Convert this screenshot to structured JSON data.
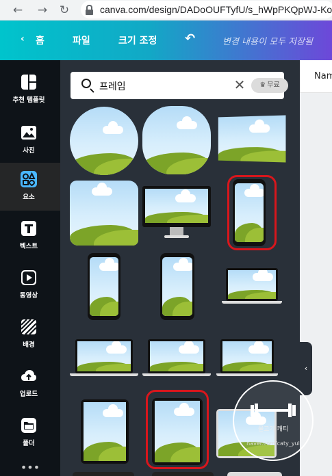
{
  "browser": {
    "url": "canva.com/design/DADoOUFTyfU/s_hWpPKQpWJ-Ko",
    "back_icon": "arrow-left-icon",
    "forward_icon": "arrow-right-icon",
    "reload_icon": "reload-icon"
  },
  "topbar": {
    "home_label": "홈",
    "file_label": "파일",
    "resize_label": "크기 조정",
    "status": "변경 내용이 모두 저장됨"
  },
  "sidebar": {
    "items": [
      {
        "label": "추천 템플릿",
        "icon": "templates-icon"
      },
      {
        "label": "사진",
        "icon": "photo-icon"
      },
      {
        "label": "요소",
        "icon": "elements-icon"
      },
      {
        "label": "텍스트",
        "icon": "text-icon"
      },
      {
        "label": "동영상",
        "icon": "video-icon"
      },
      {
        "label": "배경",
        "icon": "background-icon"
      },
      {
        "label": "업로드",
        "icon": "upload-icon"
      },
      {
        "label": "폴더",
        "icon": "folder-icon"
      }
    ]
  },
  "search": {
    "value": "프레임",
    "badge": "무료"
  },
  "right": {
    "label": "Nam"
  },
  "watermark": {
    "title": "물고기 캐티",
    "sub": "naver.com/caty_yul"
  },
  "colors": {
    "highlight": "#d9161c",
    "panel": "#293039",
    "sidebar": "#0e1318",
    "active_icon": "#4ab7ff"
  }
}
